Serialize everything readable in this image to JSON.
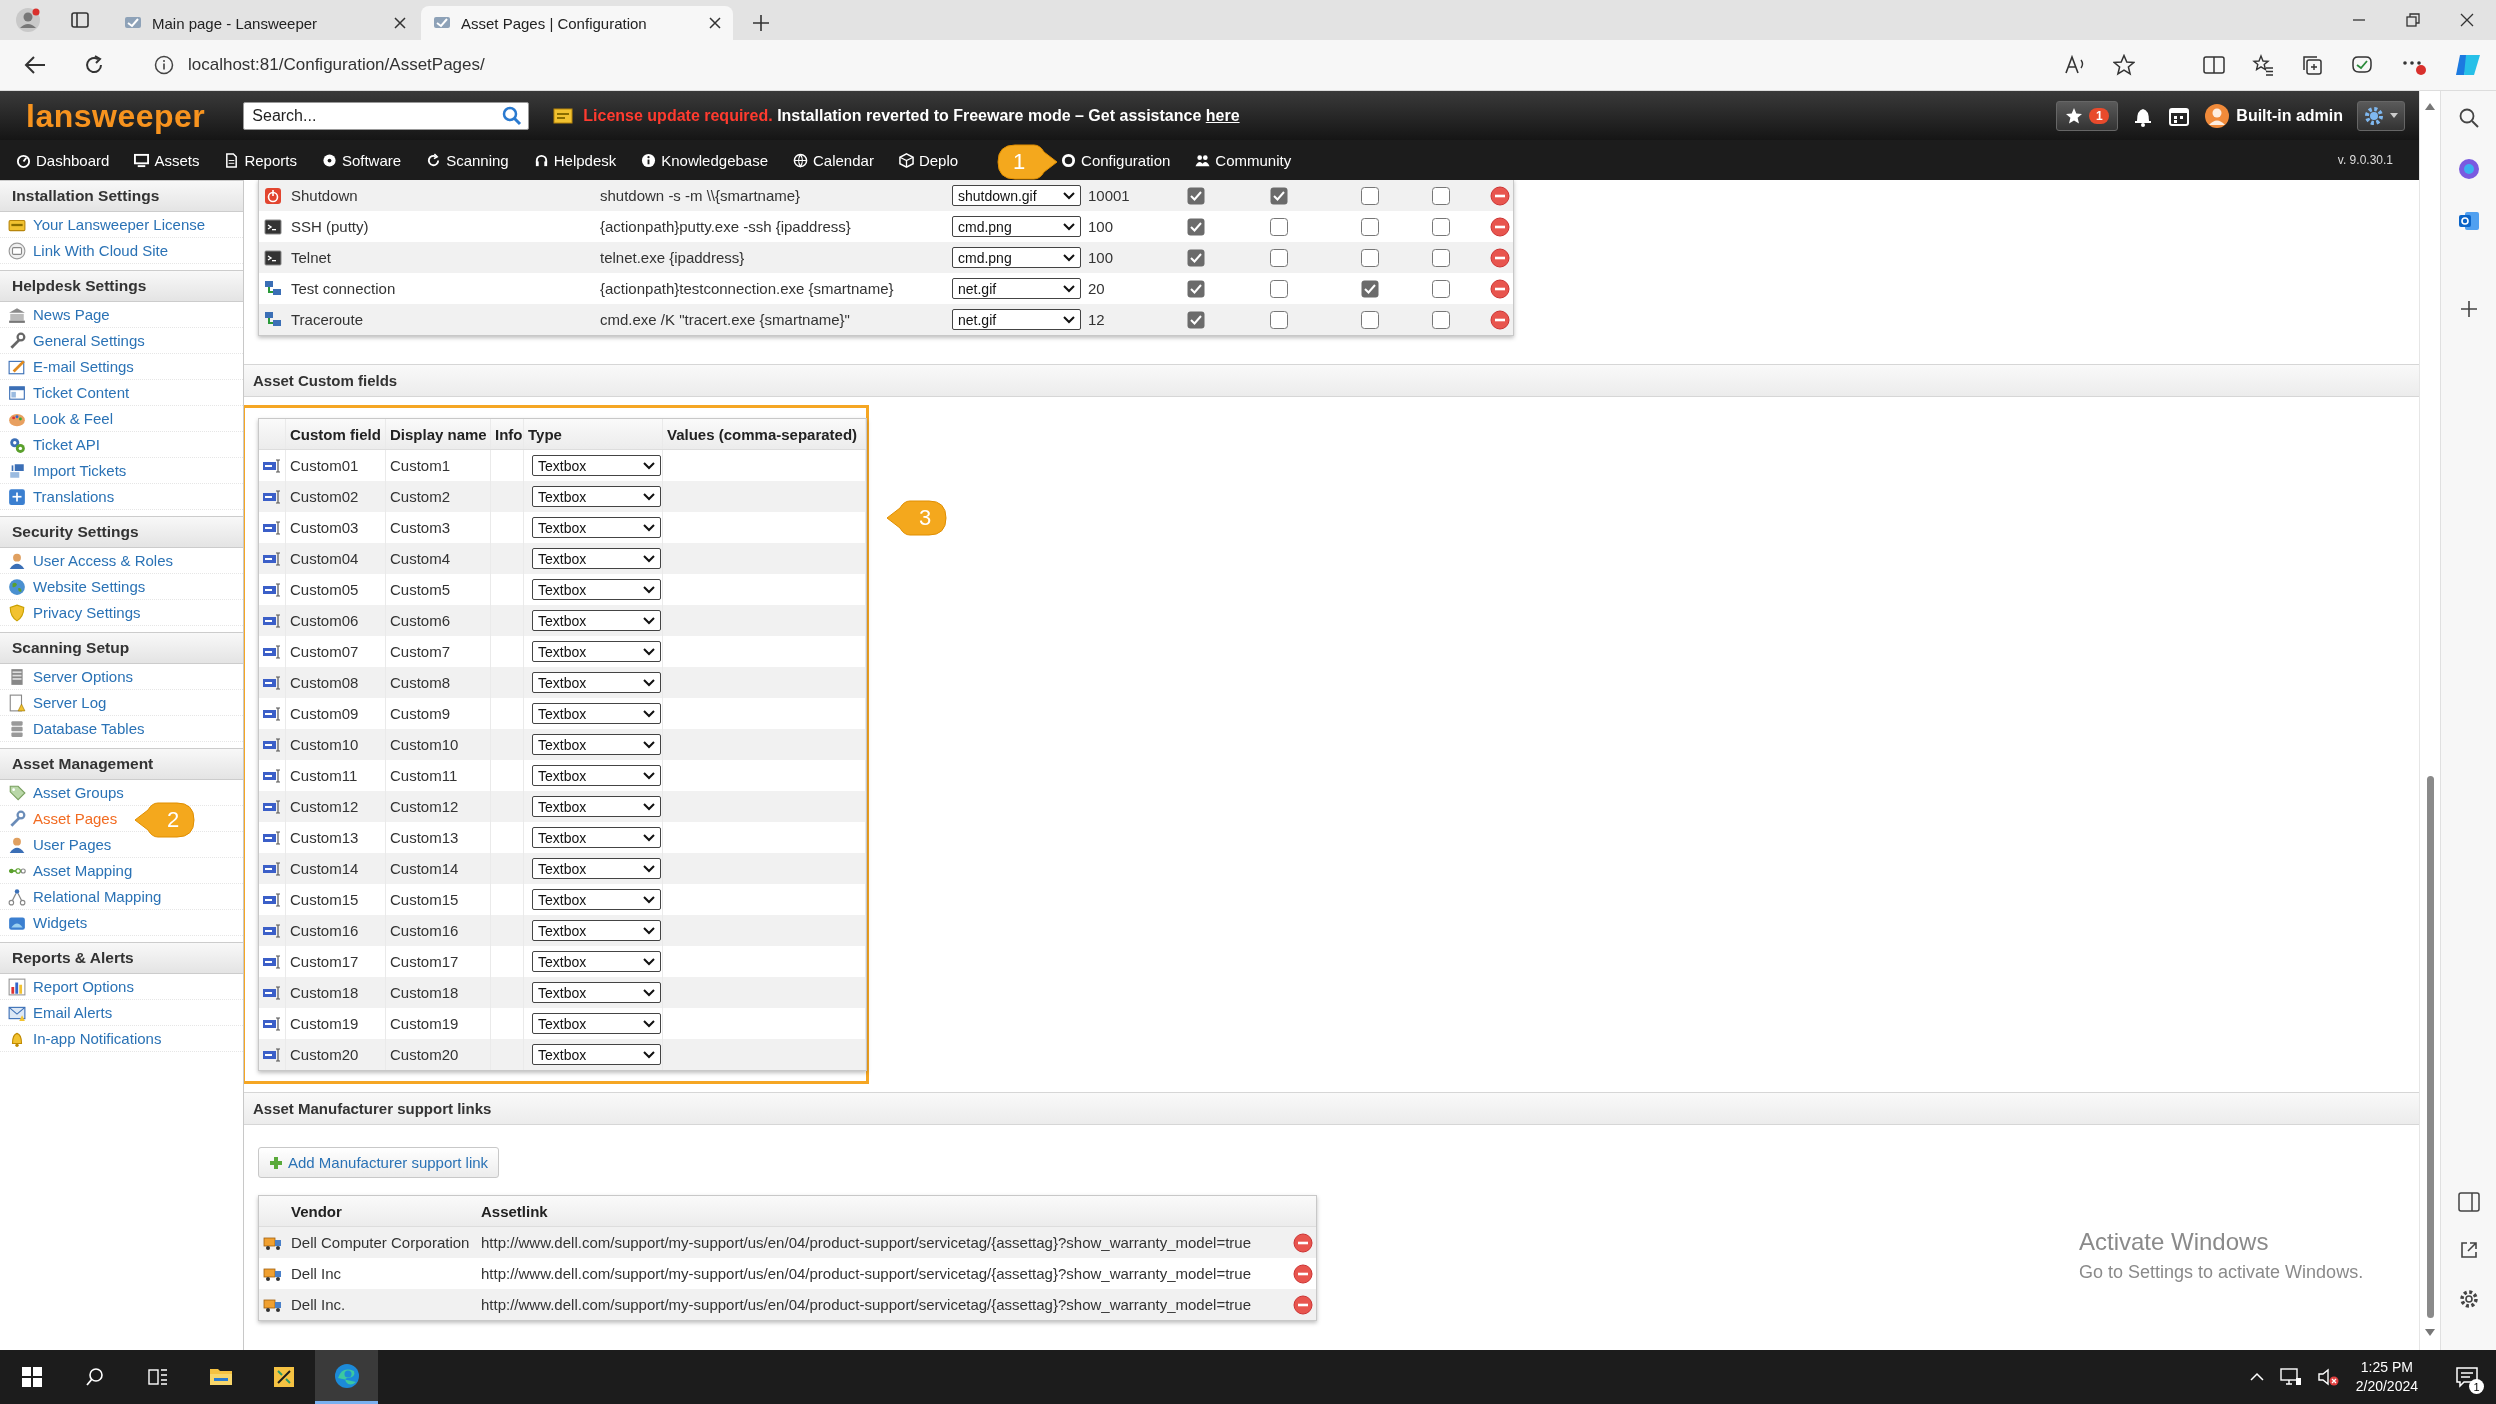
{
  "browser": {
    "tabs": [
      {
        "title": "Main page - Lansweeper",
        "selected": false
      },
      {
        "title": "Asset Pages | Configuration",
        "selected": true
      }
    ],
    "address": "localhost:81/Configuration/AssetPages/"
  },
  "header": {
    "logo": "lansweeper",
    "search": {
      "placeholder": "Search..."
    },
    "alert": {
      "warning": "License update required.",
      "message": "Installation reverted to Freeware mode – Get assistance",
      "link": "here"
    },
    "favorites_badge": "1",
    "user": "Built-in admin"
  },
  "nav": {
    "items": [
      {
        "label": "Dashboard"
      },
      {
        "label": "Assets"
      },
      {
        "label": "Reports"
      },
      {
        "label": "Software"
      },
      {
        "label": "Scanning"
      },
      {
        "label": "Helpdesk"
      },
      {
        "label": "Knowledgebase"
      },
      {
        "label": "Calendar"
      },
      {
        "label": "Deplo"
      },
      {
        "label": "Configuration"
      },
      {
        "label": "Community"
      }
    ],
    "version": "v. 9.0.30.1"
  },
  "sidebar": {
    "sections": [
      {
        "title": "Installation Settings",
        "items": [
          {
            "label": "Your Lansweeper License",
            "selected": false
          },
          {
            "label": "Link With Cloud Site",
            "selected": false
          }
        ]
      },
      {
        "title": "Helpdesk Settings",
        "items": [
          {
            "label": "News Page",
            "selected": false
          },
          {
            "label": "General Settings",
            "selected": false
          },
          {
            "label": "E-mail Settings",
            "selected": false
          },
          {
            "label": "Ticket Content",
            "selected": false
          },
          {
            "label": "Look & Feel",
            "selected": false
          },
          {
            "label": "Ticket API",
            "selected": false
          },
          {
            "label": "Import Tickets",
            "selected": false
          },
          {
            "label": "Translations",
            "selected": false
          }
        ]
      },
      {
        "title": "Security Settings",
        "items": [
          {
            "label": "User Access & Roles",
            "selected": false
          },
          {
            "label": "Website Settings",
            "selected": false
          },
          {
            "label": "Privacy Settings",
            "selected": false
          }
        ]
      },
      {
        "title": "Scanning Setup",
        "items": [
          {
            "label": "Server Options",
            "selected": false
          },
          {
            "label": "Server Log",
            "selected": false
          },
          {
            "label": "Database Tables",
            "selected": false
          }
        ]
      },
      {
        "title": "Asset Management",
        "items": [
          {
            "label": "Asset Groups",
            "selected": false
          },
          {
            "label": "Asset Pages",
            "selected": true
          },
          {
            "label": "User Pages",
            "selected": false
          },
          {
            "label": "Asset Mapping",
            "selected": false
          },
          {
            "label": "Relational Mapping",
            "selected": false
          },
          {
            "label": "Widgets",
            "selected": false
          }
        ]
      },
      {
        "title": "Reports & Alerts",
        "items": [
          {
            "label": "Report Options",
            "selected": false
          },
          {
            "label": "Email Alerts",
            "selected": false
          },
          {
            "label": "In-app Notifications",
            "selected": false
          }
        ]
      }
    ]
  },
  "actions_table": {
    "rows": [
      {
        "name": "Shutdown",
        "command": "shutdown -s -m \\\\{smartname}",
        "icon": "shutdown.gif",
        "sort": "10001",
        "checks": [
          true,
          true,
          false,
          false
        ]
      },
      {
        "name": "SSH (putty)",
        "command": "{actionpath}putty.exe -ssh {ipaddress}",
        "icon": "cmd.png",
        "sort": "100",
        "checks": [
          true,
          false,
          false,
          false
        ]
      },
      {
        "name": "Telnet",
        "command": "telnet.exe {ipaddress}",
        "icon": "cmd.png",
        "sort": "100",
        "checks": [
          true,
          false,
          false,
          false
        ]
      },
      {
        "name": "Test connection",
        "command": "{actionpath}testconnection.exe {smartname}",
        "icon": "net.gif",
        "sort": "20",
        "checks": [
          true,
          false,
          true,
          false
        ]
      },
      {
        "name": "Traceroute",
        "command": "cmd.exe /K \"tracert.exe {smartname}\"",
        "icon": "net.gif",
        "sort": "12",
        "checks": [
          true,
          false,
          false,
          false
        ]
      }
    ]
  },
  "custom_fields": {
    "title": "Asset Custom fields",
    "columns": [
      "Custom field",
      "Display name",
      "Info",
      "Type",
      "Values (comma-separated)"
    ],
    "rows": [
      {
        "field": "Custom01",
        "display_name": "Custom1",
        "type": "Textbox"
      },
      {
        "field": "Custom02",
        "display_name": "Custom2",
        "type": "Textbox"
      },
      {
        "field": "Custom03",
        "display_name": "Custom3",
        "type": "Textbox"
      },
      {
        "field": "Custom04",
        "display_name": "Custom4",
        "type": "Textbox"
      },
      {
        "field": "Custom05",
        "display_name": "Custom5",
        "type": "Textbox"
      },
      {
        "field": "Custom06",
        "display_name": "Custom6",
        "type": "Textbox"
      },
      {
        "field": "Custom07",
        "display_name": "Custom7",
        "type": "Textbox"
      },
      {
        "field": "Custom08",
        "display_name": "Custom8",
        "type": "Textbox"
      },
      {
        "field": "Custom09",
        "display_name": "Custom9",
        "type": "Textbox"
      },
      {
        "field": "Custom10",
        "display_name": "Custom10",
        "type": "Textbox"
      },
      {
        "field": "Custom11",
        "display_name": "Custom11",
        "type": "Textbox"
      },
      {
        "field": "Custom12",
        "display_name": "Custom12",
        "type": "Textbox"
      },
      {
        "field": "Custom13",
        "display_name": "Custom13",
        "type": "Textbox"
      },
      {
        "field": "Custom14",
        "display_name": "Custom14",
        "type": "Textbox"
      },
      {
        "field": "Custom15",
        "display_name": "Custom15",
        "type": "Textbox"
      },
      {
        "field": "Custom16",
        "display_name": "Custom16",
        "type": "Textbox"
      },
      {
        "field": "Custom17",
        "display_name": "Custom17",
        "type": "Textbox"
      },
      {
        "field": "Custom18",
        "display_name": "Custom18",
        "type": "Textbox"
      },
      {
        "field": "Custom19",
        "display_name": "Custom19",
        "type": "Textbox"
      },
      {
        "field": "Custom20",
        "display_name": "Custom20",
        "type": "Textbox"
      }
    ]
  },
  "manufacturer_links": {
    "title": "Asset Manufacturer support links",
    "add_button": "Add Manufacturer support link",
    "columns": [
      "Vendor",
      "Assetlink"
    ],
    "rows": [
      {
        "vendor": "Dell Computer Corporation",
        "link": "http://www.dell.com/support/my-support/us/en/04/product-support/servicetag/{assettag}?show_warranty_model=true"
      },
      {
        "vendor": "Dell Inc",
        "link": "http://www.dell.com/support/my-support/us/en/04/product-support/servicetag/{assettag}?show_warranty_model=true"
      },
      {
        "vendor": "Dell Inc.",
        "link": "http://www.dell.com/support/my-support/us/en/04/product-support/servicetag/{assettag}?show_warranty_model=true"
      }
    ]
  },
  "annotations": [
    {
      "label": "1"
    },
    {
      "label": "2"
    },
    {
      "label": "3"
    }
  ],
  "activation_notice": {
    "title": "Activate Windows",
    "subtitle": "Go to Settings to activate Windows."
  },
  "taskbar": {
    "time": "1:25 PM",
    "date": "2/20/2024",
    "notifications": "1"
  }
}
